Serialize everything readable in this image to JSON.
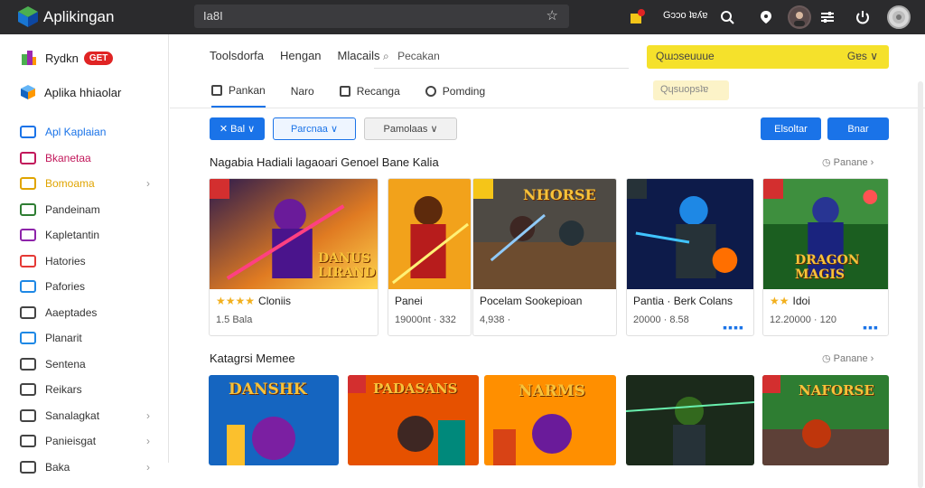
{
  "app": {
    "title": "Aplikingan",
    "search_value": "Ia8I",
    "user_label": "Gɔɔo ʇɐʎɐ"
  },
  "colors": {
    "topbar": "#2b2b2d",
    "accent_blue": "#1a73e8",
    "brand_red": "#e02424",
    "yellow_bar": "#f5e12b"
  },
  "sidebar": {
    "brand": "Rydkn",
    "badge": "GET",
    "section_title": "Aplika hhiaolar",
    "items": [
      {
        "label": "Apl Kaplaian",
        "icon": "app-icon",
        "color": "#1a73e8",
        "has_chevron": false
      },
      {
        "label": "Bkanetaa",
        "icon": "folder-icon",
        "color": "#c2185b",
        "has_chevron": false
      },
      {
        "label": "Bomoama",
        "icon": "star-icon",
        "color": "#e0a400",
        "has_chevron": true
      },
      {
        "label": "Pandeinam",
        "icon": "list-icon",
        "color": "#2e7d32",
        "has_chevron": false
      },
      {
        "label": "Kapletantin",
        "icon": "tag-icon",
        "color": "#8e24aa",
        "has_chevron": false
      },
      {
        "label": "Hatories",
        "icon": "grid-icon",
        "color": "#e53935",
        "has_chevron": false
      },
      {
        "label": "Pafories",
        "icon": "doc-icon",
        "color": "#1e88e5",
        "has_chevron": false
      },
      {
        "label": "Aaeptades",
        "icon": "person-icon",
        "color": "#444444",
        "has_chevron": false
      },
      {
        "label": "Planarit",
        "icon": "mail-icon",
        "color": "#1e88e5",
        "has_chevron": false
      },
      {
        "label": "Sentena",
        "icon": "mail-icon",
        "color": "#444444",
        "has_chevron": false
      },
      {
        "label": "Reikars",
        "icon": "edit-icon",
        "color": "#444444",
        "has_chevron": false
      },
      {
        "label": "Sanalagkat",
        "icon": "chart-icon",
        "color": "#444444",
        "has_chevron": true
      },
      {
        "label": "Panieisgat",
        "icon": "box-icon",
        "color": "#444444",
        "has_chevron": true
      },
      {
        "label": "Baka",
        "icon": "settings-icon",
        "color": "#444444",
        "has_chevron": true
      }
    ]
  },
  "header": {
    "tabs": [
      "Toolsdorfa",
      "Hengan",
      "Mlacails"
    ],
    "search_placeholder": "Pecakan",
    "yellow_left": "Qɯɔseuuue",
    "yellow_right": "Gɐs ∨",
    "subtabs": [
      {
        "label": "Pankan",
        "active": true,
        "icon": "tv-icon"
      },
      {
        "label": "Naro",
        "active": false,
        "icon": ""
      },
      {
        "label": "Recanga",
        "active": false,
        "icon": "doc-icon"
      },
      {
        "label": "Pomding",
        "active": false,
        "icon": "camera-icon"
      }
    ],
    "pale_pill": "Qɥsuopsʇɐ"
  },
  "toolbar": {
    "btn1": "✕ Bal ∨",
    "btn2": "Parcnaa ∨",
    "btn3": "Pamolaas ∨",
    "btn4": "Elsoltar",
    "btn5": "Bnar"
  },
  "section1": {
    "title": "Nagabia Hadiali lagaoari Genoel Bane Kalia",
    "more": "Panane",
    "cards": [
      {
        "title": "Cloniis",
        "meta": "1.5 Bala",
        "stars": "★★★★",
        "art_text": "DANUS\nLIRAND"
      },
      {
        "title": "Panei",
        "meta": "19000nt · 332",
        "stars": "",
        "art_text": ""
      },
      {
        "title": "Pocelam Sookepioan",
        "meta": "4,938 ·",
        "stars": "",
        "art_text": "NHORSE"
      },
      {
        "title": "Pantia · Berk Colans",
        "meta": "20000 · 8.58",
        "stars": "",
        "art_text": ""
      },
      {
        "title": "Idoi",
        "meta": "12.20000 · 120",
        "stars": "★★",
        "art_text": "DRAGON\nMAGIS"
      }
    ]
  },
  "section2": {
    "title": "Katagrsi Memee",
    "more": "Panane",
    "cards": [
      {
        "art_text": "DANSHK"
      },
      {
        "art_text": "PADASANS"
      },
      {
        "art_text": "NARMS"
      },
      {
        "art_text": ""
      },
      {
        "art_text": "NAFORSE"
      }
    ]
  }
}
